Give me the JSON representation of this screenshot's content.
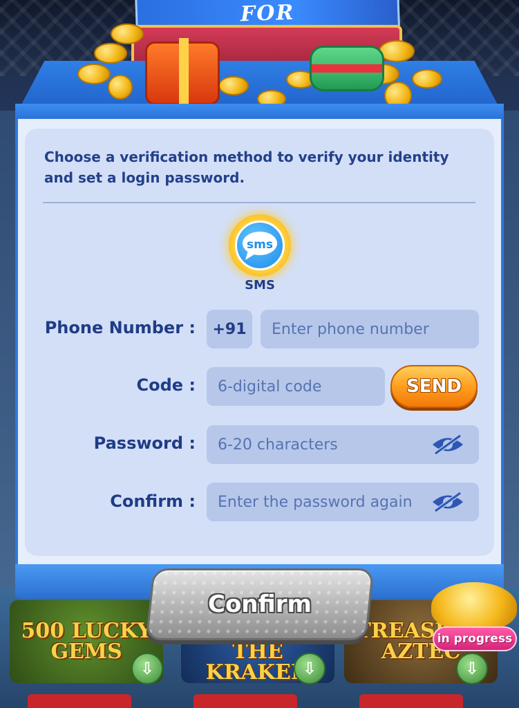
{
  "banner": {
    "text": "FOR"
  },
  "dialog": {
    "instructions": "Choose a verification method to verify your identity and set a login password.",
    "method": {
      "icon": "sms-bubble-icon",
      "icon_text": "sms",
      "label": "SMS"
    },
    "phone": {
      "label": "Phone Number :",
      "country_code": "+91",
      "placeholder": "Enter phone number"
    },
    "code": {
      "label": "Code :",
      "placeholder": "6-digital code",
      "send_label": "SEND"
    },
    "password": {
      "label": "Password :",
      "placeholder": "6-20 characters",
      "toggle_icon": "eye-slash-icon"
    },
    "confirm_password": {
      "label": "Confirm :",
      "placeholder": "Enter the password again",
      "toggle_icon": "eye-slash-icon"
    },
    "confirm_button": "Confirm"
  },
  "background_games": [
    {
      "title": "500 LUCKY GEMS"
    },
    {
      "title": "POWER OF THE KRAKEN"
    },
    {
      "title": "TREASURE AZTEC"
    }
  ],
  "event_badge": "in progress",
  "colors": {
    "label_text": "#1f3c86",
    "panel_bg": "#d3dff7",
    "input_bg": "#b7c7ea",
    "send_button": "#ff9e1e",
    "confirm_button": "#b3b3b3",
    "badge": "#d8237a"
  }
}
